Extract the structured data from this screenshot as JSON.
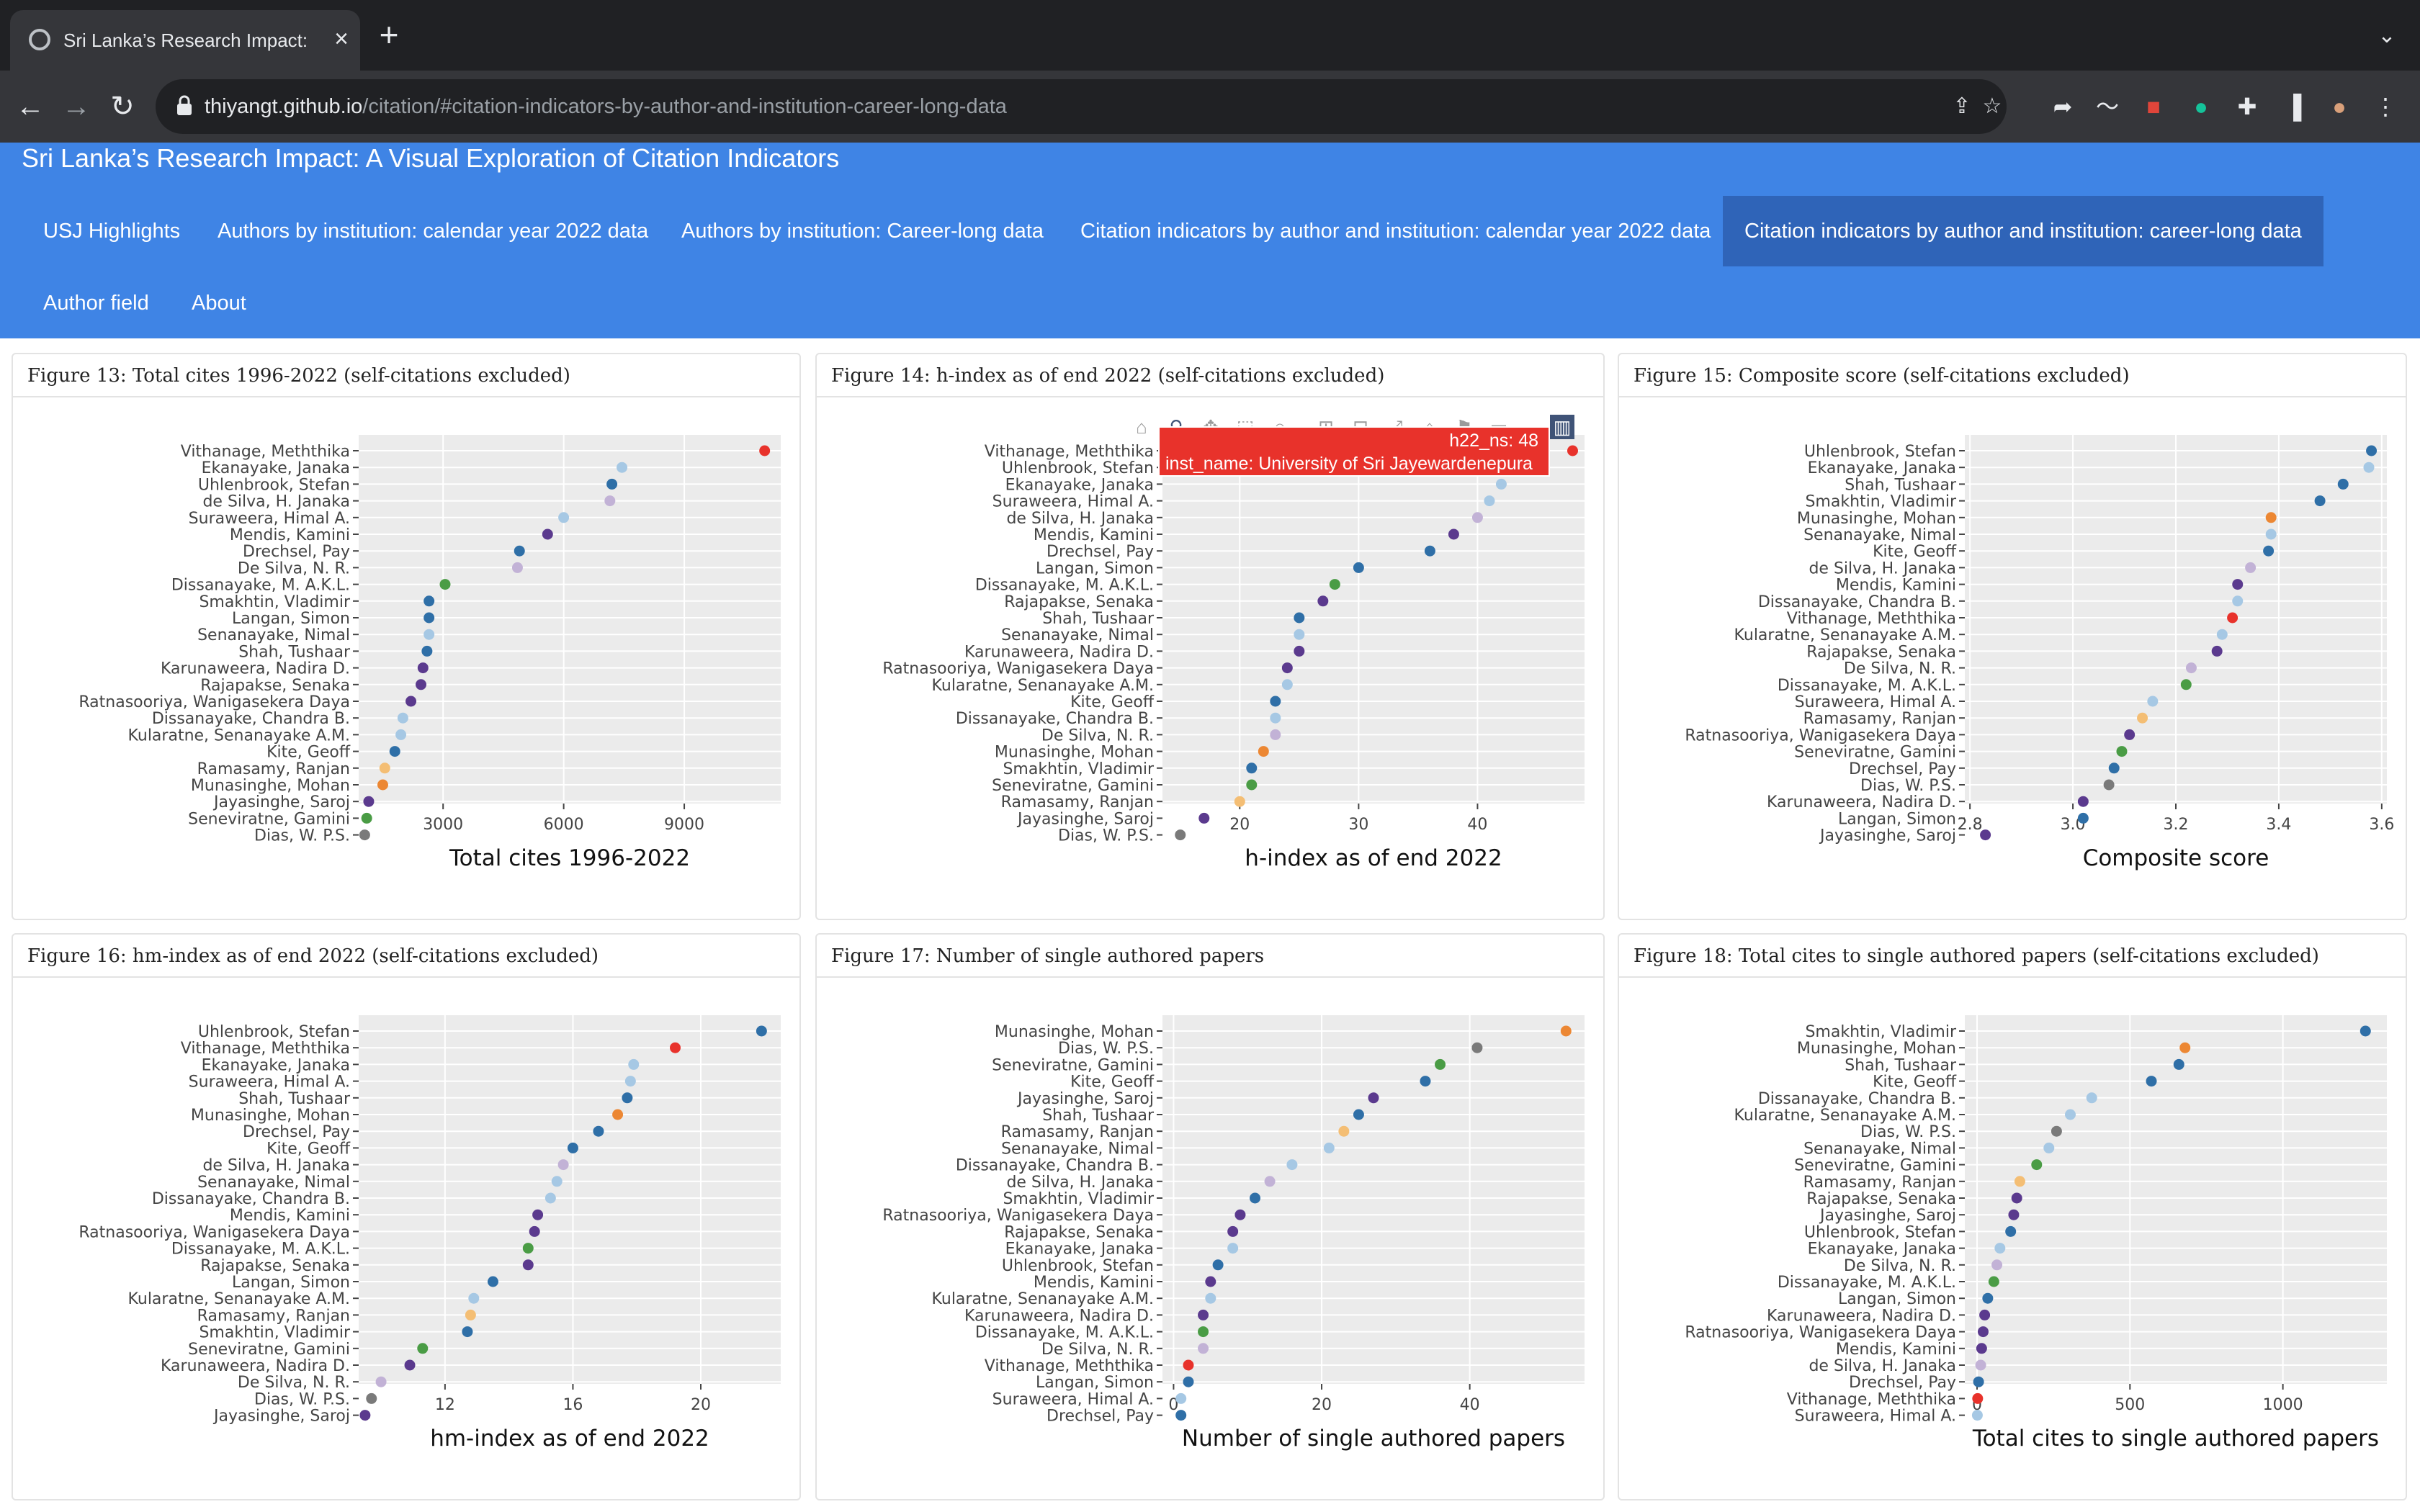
{
  "browser": {
    "tab_title": "Sri Lanka’s Research Impact: A",
    "tab_close": "×",
    "new_tab": "+",
    "tab_list": "⌄",
    "url_host": "thiyangt.github.io",
    "url_path": "/citation/#citation-indicators-by-author-and-institution-career-long-data",
    "back": "←",
    "forward": "→",
    "reload": "↻"
  },
  "app": {
    "title": "Sri Lanka’s Research Impact: A Visual Exploration of Citation Indicators",
    "tabs": [
      "USJ Highlights",
      "Authors by institution: calendar year 2022 data",
      "Authors by institution: Career-long data",
      "Citation indicators by author and institution: calendar year 2022 data",
      "Citation indicators by author and institution: career-long data",
      "Author field",
      "About"
    ],
    "active_tab": 4
  },
  "institution_colors": {
    "University of Sri Jayewardenepura": "#e8322b",
    "dark_blue": "#2f6fa7",
    "light_blue": "#a6c8e4",
    "lavender": "#c2b2d6",
    "purple": "#5b3a8e",
    "green": "#4a9c45",
    "orange": "#ec8733",
    "light_orange": "#f4be74",
    "gray": "#7a7a7a"
  },
  "tooltip": {
    "line1": "h22_ns: 48",
    "line2": "inst_name: University of Sri Jayewardenepura"
  },
  "chart_data": [
    {
      "type": "scatter",
      "title": "Figure 13: Total cites 1996-2022 (self-citations excluded)",
      "xlabel": "Total cites 1996-2022",
      "xlim": [
        900,
        11400
      ],
      "xticks": [
        3000,
        6000,
        9000
      ],
      "xtick_labels": [
        "3000",
        "6000",
        "9000"
      ],
      "points": [
        {
          "label": "Vithanage, Meththika",
          "x": 11000,
          "color": "#e8322b"
        },
        {
          "label": "Ekanayake, Janaka",
          "x": 7450,
          "color": "#a6c8e4"
        },
        {
          "label": "Uhlenbrook, Stefan",
          "x": 7200,
          "color": "#2f6fa7"
        },
        {
          "label": "de Silva, H. Janaka",
          "x": 7150,
          "color": "#c2b2d6"
        },
        {
          "label": "Suraweera, Himal A.",
          "x": 6000,
          "color": "#a6c8e4"
        },
        {
          "label": "Mendis, Kamini",
          "x": 5600,
          "color": "#5b3a8e"
        },
        {
          "label": "Drechsel, Pay",
          "x": 4900,
          "color": "#2f6fa7"
        },
        {
          "label": "De Silva, N. R.",
          "x": 4850,
          "color": "#c2b2d6"
        },
        {
          "label": "Dissanayake, M. A.K.L.",
          "x": 3050,
          "color": "#4a9c45"
        },
        {
          "label": "Smakhtin, Vladimir",
          "x": 2650,
          "color": "#2f6fa7"
        },
        {
          "label": "Langan, Simon",
          "x": 2650,
          "color": "#2f6fa7"
        },
        {
          "label": "Senanayake, Nimal",
          "x": 2650,
          "color": "#a6c8e4"
        },
        {
          "label": "Shah, Tushaar",
          "x": 2600,
          "color": "#2f6fa7"
        },
        {
          "label": "Karunaweera, Nadira D.",
          "x": 2500,
          "color": "#5b3a8e"
        },
        {
          "label": "Rajapakse, Senaka",
          "x": 2450,
          "color": "#5b3a8e"
        },
        {
          "label": "Ratnasooriya, Wanigasekera Daya",
          "x": 2200,
          "color": "#5b3a8e"
        },
        {
          "label": "Dissanayake, Chandra B.",
          "x": 2000,
          "color": "#a6c8e4"
        },
        {
          "label": "Kularatne, Senanayake A.M.",
          "x": 1950,
          "color": "#a6c8e4"
        },
        {
          "label": "Kite, Geoff",
          "x": 1800,
          "color": "#2f6fa7"
        },
        {
          "label": "Ramasamy, Ranjan",
          "x": 1550,
          "color": "#f4be74"
        },
        {
          "label": "Munasinghe, Mohan",
          "x": 1500,
          "color": "#ec8733"
        },
        {
          "label": "Jayasinghe, Saroj",
          "x": 1150,
          "color": "#5b3a8e"
        },
        {
          "label": "Seneviratne, Gamini",
          "x": 1100,
          "color": "#4a9c45"
        },
        {
          "label": "Dias, W. P.S.",
          "x": 1050,
          "color": "#7a7a7a"
        }
      ]
    },
    {
      "type": "scatter",
      "title": "Figure 14: h-index as of end 2022 (self-citations excluded)",
      "xlabel": "h-index as of end 2022",
      "xlim": [
        13.5,
        49
      ],
      "xticks": [
        20,
        30,
        40
      ],
      "xtick_labels": [
        "20",
        "30",
        "40"
      ],
      "points": [
        {
          "label": "Vithanage, Meththika",
          "x": 48,
          "color": "#e8322b"
        },
        {
          "label": "Uhlenbrook, Stefan",
          "x": 42,
          "color": "#2f6fa7"
        },
        {
          "label": "Ekanayake, Janaka",
          "x": 42,
          "color": "#a6c8e4"
        },
        {
          "label": "Suraweera, Himal A.",
          "x": 41,
          "color": "#a6c8e4"
        },
        {
          "label": "de Silva, H. Janaka",
          "x": 40,
          "color": "#c2b2d6"
        },
        {
          "label": "Mendis, Kamini",
          "x": 38,
          "color": "#5b3a8e"
        },
        {
          "label": "Drechsel, Pay",
          "x": 36,
          "color": "#2f6fa7"
        },
        {
          "label": "Langan, Simon",
          "x": 30,
          "color": "#2f6fa7"
        },
        {
          "label": "Dissanayake, M. A.K.L.",
          "x": 28,
          "color": "#4a9c45"
        },
        {
          "label": "Rajapakse, Senaka",
          "x": 27,
          "color": "#5b3a8e"
        },
        {
          "label": "Shah, Tushaar",
          "x": 25,
          "color": "#2f6fa7"
        },
        {
          "label": "Senanayake, Nimal",
          "x": 25,
          "color": "#a6c8e4"
        },
        {
          "label": "Karunaweera, Nadira D.",
          "x": 25,
          "color": "#5b3a8e"
        },
        {
          "label": "Ratnasooriya, Wanigasekera Daya",
          "x": 24,
          "color": "#5b3a8e"
        },
        {
          "label": "Kularatne, Senanayake A.M.",
          "x": 24,
          "color": "#a6c8e4"
        },
        {
          "label": "Kite, Geoff",
          "x": 23,
          "color": "#2f6fa7"
        },
        {
          "label": "Dissanayake, Chandra B.",
          "x": 23,
          "color": "#a6c8e4"
        },
        {
          "label": "De Silva, N. R.",
          "x": 23,
          "color": "#c2b2d6"
        },
        {
          "label": "Munasinghe, Mohan",
          "x": 22,
          "color": "#ec8733"
        },
        {
          "label": "Smakhtin, Vladimir",
          "x": 21,
          "color": "#2f6fa7"
        },
        {
          "label": "Seneviratne, Gamini",
          "x": 21,
          "color": "#4a9c45"
        },
        {
          "label": "Ramasamy, Ranjan",
          "x": 20,
          "color": "#f4be74"
        },
        {
          "label": "Jayasinghe, Saroj",
          "x": 17,
          "color": "#5b3a8e"
        },
        {
          "label": "Dias, W. P.S.",
          "x": 15,
          "color": "#7a7a7a"
        }
      ]
    },
    {
      "type": "scatter",
      "title": "Figure 15: Composite score (self-citations excluded)",
      "xlabel": "Composite score",
      "xlim": [
        2.79,
        3.61
      ],
      "xticks": [
        2.8,
        3.0,
        3.2,
        3.4,
        3.6
      ],
      "xtick_labels": [
        "2.8",
        "3.0",
        "3.2",
        "3.4",
        "3.6"
      ],
      "points": [
        {
          "label": "Uhlenbrook, Stefan",
          "x": 3.58,
          "color": "#2f6fa7"
        },
        {
          "label": "Ekanayake, Janaka",
          "x": 3.575,
          "color": "#a6c8e4"
        },
        {
          "label": "Shah, Tushaar",
          "x": 3.525,
          "color": "#2f6fa7"
        },
        {
          "label": "Smakhtin, Vladimir",
          "x": 3.48,
          "color": "#2f6fa7"
        },
        {
          "label": "Munasinghe, Mohan",
          "x": 3.385,
          "color": "#ec8733"
        },
        {
          "label": "Senanayake, Nimal",
          "x": 3.385,
          "color": "#a6c8e4"
        },
        {
          "label": "Kite, Geoff",
          "x": 3.38,
          "color": "#2f6fa7"
        },
        {
          "label": "de Silva, H. Janaka",
          "x": 3.345,
          "color": "#c2b2d6"
        },
        {
          "label": "Mendis, Kamini",
          "x": 3.32,
          "color": "#5b3a8e"
        },
        {
          "label": "Dissanayake, Chandra B.",
          "x": 3.32,
          "color": "#a6c8e4"
        },
        {
          "label": "Vithanage, Meththika",
          "x": 3.31,
          "color": "#e8322b"
        },
        {
          "label": "Kularatne, Senanayake A.M.",
          "x": 3.29,
          "color": "#a6c8e4"
        },
        {
          "label": "Rajapakse, Senaka",
          "x": 3.28,
          "color": "#5b3a8e"
        },
        {
          "label": "De Silva, N. R.",
          "x": 3.23,
          "color": "#c2b2d6"
        },
        {
          "label": "Dissanayake, M. A.K.L.",
          "x": 3.22,
          "color": "#4a9c45"
        },
        {
          "label": "Suraweera, Himal A.",
          "x": 3.155,
          "color": "#a6c8e4"
        },
        {
          "label": "Ramasamy, Ranjan",
          "x": 3.135,
          "color": "#f4be74"
        },
        {
          "label": "Ratnasooriya, Wanigasekera Daya",
          "x": 3.11,
          "color": "#5b3a8e"
        },
        {
          "label": "Seneviratne, Gamini",
          "x": 3.095,
          "color": "#4a9c45"
        },
        {
          "label": "Drechsel, Pay",
          "x": 3.08,
          "color": "#2f6fa7"
        },
        {
          "label": "Dias, W. P.S.",
          "x": 3.07,
          "color": "#7a7a7a"
        },
        {
          "label": "Karunaweera, Nadira D.",
          "x": 3.02,
          "color": "#5b3a8e"
        },
        {
          "label": "Langan, Simon",
          "x": 3.02,
          "color": "#2f6fa7"
        },
        {
          "label": "Jayasinghe, Saroj",
          "x": 2.83,
          "color": "#5b3a8e"
        }
      ]
    },
    {
      "type": "scatter",
      "title": "Figure 16: hm-index as of end 2022 (self-citations excluded)",
      "xlabel": "hm-index as of end 2022",
      "xlim": [
        9.3,
        22.5
      ],
      "xticks": [
        12,
        16,
        20
      ],
      "xtick_labels": [
        "12",
        "16",
        "20"
      ],
      "points": [
        {
          "label": "Uhlenbrook, Stefan",
          "x": 21.9,
          "color": "#2f6fa7"
        },
        {
          "label": "Vithanage, Meththika",
          "x": 19.2,
          "color": "#e8322b"
        },
        {
          "label": "Ekanayake, Janaka",
          "x": 17.9,
          "color": "#a6c8e4"
        },
        {
          "label": "Suraweera, Himal A.",
          "x": 17.8,
          "color": "#a6c8e4"
        },
        {
          "label": "Shah, Tushaar",
          "x": 17.7,
          "color": "#2f6fa7"
        },
        {
          "label": "Munasinghe, Mohan",
          "x": 17.4,
          "color": "#ec8733"
        },
        {
          "label": "Drechsel, Pay",
          "x": 16.8,
          "color": "#2f6fa7"
        },
        {
          "label": "Kite, Geoff",
          "x": 16.0,
          "color": "#2f6fa7"
        },
        {
          "label": "de Silva, H. Janaka",
          "x": 15.7,
          "color": "#c2b2d6"
        },
        {
          "label": "Senanayake, Nimal",
          "x": 15.5,
          "color": "#a6c8e4"
        },
        {
          "label": "Dissanayake, Chandra B.",
          "x": 15.3,
          "color": "#a6c8e4"
        },
        {
          "label": "Mendis, Kamini",
          "x": 14.9,
          "color": "#5b3a8e"
        },
        {
          "label": "Ratnasooriya, Wanigasekera Daya",
          "x": 14.8,
          "color": "#5b3a8e"
        },
        {
          "label": "Dissanayake, M. A.K.L.",
          "x": 14.6,
          "color": "#4a9c45"
        },
        {
          "label": "Rajapakse, Senaka",
          "x": 14.6,
          "color": "#5b3a8e"
        },
        {
          "label": "Langan, Simon",
          "x": 13.5,
          "color": "#2f6fa7"
        },
        {
          "label": "Kularatne, Senanayake A.M.",
          "x": 12.9,
          "color": "#a6c8e4"
        },
        {
          "label": "Ramasamy, Ranjan",
          "x": 12.8,
          "color": "#f4be74"
        },
        {
          "label": "Smakhtin, Vladimir",
          "x": 12.7,
          "color": "#2f6fa7"
        },
        {
          "label": "Seneviratne, Gamini",
          "x": 11.3,
          "color": "#4a9c45"
        },
        {
          "label": "Karunaweera, Nadira D.",
          "x": 10.9,
          "color": "#5b3a8e"
        },
        {
          "label": "De Silva, N. R.",
          "x": 10.0,
          "color": "#c2b2d6"
        },
        {
          "label": "Dias, W. P.S.",
          "x": 9.7,
          "color": "#7a7a7a"
        },
        {
          "label": "Jayasinghe, Saroj",
          "x": 9.5,
          "color": "#5b3a8e"
        }
      ]
    },
    {
      "type": "scatter",
      "title": "Figure 17: Number of single authored papers",
      "xlabel": "Number of single authored papers",
      "xlim": [
        -1.5,
        55.5
      ],
      "xticks": [
        0,
        20,
        40
      ],
      "xtick_labels": [
        "0",
        "20",
        "40"
      ],
      "points": [
        {
          "label": "Munasinghe, Mohan",
          "x": 53,
          "color": "#ec8733"
        },
        {
          "label": "Dias, W. P.S.",
          "x": 41,
          "color": "#7a7a7a"
        },
        {
          "label": "Seneviratne, Gamini",
          "x": 36,
          "color": "#4a9c45"
        },
        {
          "label": "Kite, Geoff",
          "x": 34,
          "color": "#2f6fa7"
        },
        {
          "label": "Jayasinghe, Saroj",
          "x": 27,
          "color": "#5b3a8e"
        },
        {
          "label": "Shah, Tushaar",
          "x": 25,
          "color": "#2f6fa7"
        },
        {
          "label": "Ramasamy, Ranjan",
          "x": 23,
          "color": "#f4be74"
        },
        {
          "label": "Senanayake, Nimal",
          "x": 21,
          "color": "#a6c8e4"
        },
        {
          "label": "Dissanayake, Chandra B.",
          "x": 16,
          "color": "#a6c8e4"
        },
        {
          "label": "de Silva, H. Janaka",
          "x": 13,
          "color": "#c2b2d6"
        },
        {
          "label": "Smakhtin, Vladimir",
          "x": 11,
          "color": "#2f6fa7"
        },
        {
          "label": "Ratnasooriya, Wanigasekera Daya",
          "x": 9,
          "color": "#5b3a8e"
        },
        {
          "label": "Rajapakse, Senaka",
          "x": 8,
          "color": "#5b3a8e"
        },
        {
          "label": "Ekanayake, Janaka",
          "x": 8,
          "color": "#a6c8e4"
        },
        {
          "label": "Uhlenbrook, Stefan",
          "x": 6,
          "color": "#2f6fa7"
        },
        {
          "label": "Mendis, Kamini",
          "x": 5,
          "color": "#5b3a8e"
        },
        {
          "label": "Kularatne, Senanayake A.M.",
          "x": 5,
          "color": "#a6c8e4"
        },
        {
          "label": "Karunaweera, Nadira D.",
          "x": 4,
          "color": "#5b3a8e"
        },
        {
          "label": "Dissanayake, M. A.K.L.",
          "x": 4,
          "color": "#4a9c45"
        },
        {
          "label": "De Silva, N. R.",
          "x": 4,
          "color": "#c2b2d6"
        },
        {
          "label": "Vithanage, Meththika",
          "x": 2,
          "color": "#e8322b"
        },
        {
          "label": "Langan, Simon",
          "x": 2,
          "color": "#2f6fa7"
        },
        {
          "label": "Suraweera, Himal A.",
          "x": 1,
          "color": "#a6c8e4"
        },
        {
          "label": "Drechsel, Pay",
          "x": 1,
          "color": "#2f6fa7"
        }
      ]
    },
    {
      "type": "scatter",
      "title": "Figure 18: Total cites to single authored papers (self-citations excluded)",
      "xlabel": "Total cites to single authored papers",
      "xlim": [
        -40,
        1340
      ],
      "xticks": [
        0,
        500,
        1000
      ],
      "xtick_labels": [
        "0",
        "500",
        "1000"
      ],
      "points": [
        {
          "label": "Smakhtin, Vladimir",
          "x": 1270,
          "color": "#2f6fa7"
        },
        {
          "label": "Munasinghe, Mohan",
          "x": 680,
          "color": "#ec8733"
        },
        {
          "label": "Shah, Tushaar",
          "x": 660,
          "color": "#2f6fa7"
        },
        {
          "label": "Kite, Geoff",
          "x": 570,
          "color": "#2f6fa7"
        },
        {
          "label": "Dissanayake, Chandra B.",
          "x": 375,
          "color": "#a6c8e4"
        },
        {
          "label": "Kularatne, Senanayake A.M.",
          "x": 305,
          "color": "#a6c8e4"
        },
        {
          "label": "Dias, W. P.S.",
          "x": 260,
          "color": "#7a7a7a"
        },
        {
          "label": "Senanayake, Nimal",
          "x": 235,
          "color": "#a6c8e4"
        },
        {
          "label": "Seneviratne, Gamini",
          "x": 195,
          "color": "#4a9c45"
        },
        {
          "label": "Ramasamy, Ranjan",
          "x": 140,
          "color": "#f4be74"
        },
        {
          "label": "Rajapakse, Senaka",
          "x": 130,
          "color": "#5b3a8e"
        },
        {
          "label": "Jayasinghe, Saroj",
          "x": 120,
          "color": "#5b3a8e"
        },
        {
          "label": "Uhlenbrook, Stefan",
          "x": 110,
          "color": "#2f6fa7"
        },
        {
          "label": "Ekanayake, Janaka",
          "x": 75,
          "color": "#a6c8e4"
        },
        {
          "label": "De Silva, N. R.",
          "x": 65,
          "color": "#c2b2d6"
        },
        {
          "label": "Dissanayake, M. A.K.L.",
          "x": 55,
          "color": "#4a9c45"
        },
        {
          "label": "Langan, Simon",
          "x": 35,
          "color": "#2f6fa7"
        },
        {
          "label": "Karunaweera, Nadira D.",
          "x": 25,
          "color": "#5b3a8e"
        },
        {
          "label": "Ratnasooriya, Wanigasekera Daya",
          "x": 20,
          "color": "#5b3a8e"
        },
        {
          "label": "Mendis, Kamini",
          "x": 15,
          "color": "#5b3a8e"
        },
        {
          "label": "de Silva, H. Janaka",
          "x": 12,
          "color": "#c2b2d6"
        },
        {
          "label": "Drechsel, Pay",
          "x": 5,
          "color": "#2f6fa7"
        },
        {
          "label": "Vithanage, Meththika",
          "x": 2,
          "color": "#e8322b"
        },
        {
          "label": "Suraweera, Himal A.",
          "x": 1,
          "color": "#a6c8e4"
        }
      ]
    }
  ]
}
